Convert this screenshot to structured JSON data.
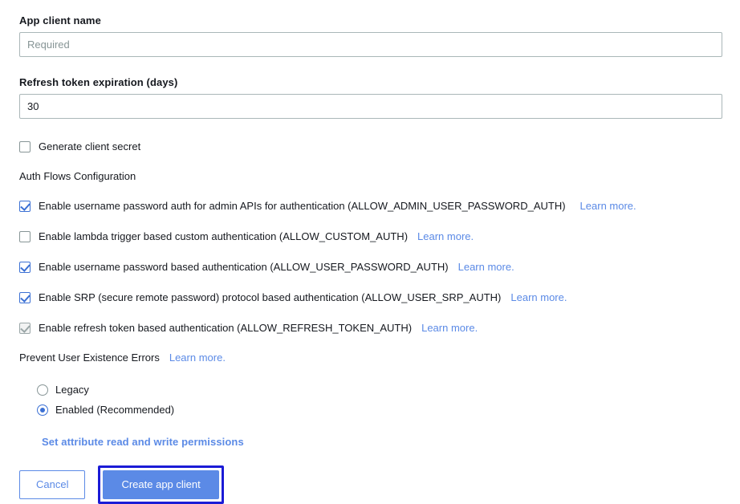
{
  "form": {
    "app_client_name": {
      "label": "App client name",
      "placeholder": "Required",
      "value": ""
    },
    "refresh_token_expiration": {
      "label": "Refresh token expiration (days)",
      "placeholder": "",
      "value": "30"
    },
    "generate_client_secret": {
      "label": "Generate client secret",
      "checked": false
    },
    "auth_flows": {
      "section_label": "Auth Flows Configuration",
      "items": [
        {
          "label": "Enable username password auth for admin APIs for authentication (ALLOW_ADMIN_USER_PASSWORD_AUTH)",
          "link": "Learn more.",
          "checked": true,
          "disabled": false
        },
        {
          "label": "Enable lambda trigger based custom authentication (ALLOW_CUSTOM_AUTH)",
          "link": "Learn more.",
          "checked": false,
          "disabled": false
        },
        {
          "label": "Enable username password based authentication (ALLOW_USER_PASSWORD_AUTH)",
          "link": "Learn more.",
          "checked": true,
          "disabled": false
        },
        {
          "label": "Enable SRP (secure remote password) protocol based authentication (ALLOW_USER_SRP_AUTH)",
          "link": "Learn more.",
          "checked": true,
          "disabled": false
        },
        {
          "label": "Enable refresh token based authentication (ALLOW_REFRESH_TOKEN_AUTH)",
          "link": "Learn more.",
          "checked": true,
          "disabled": true
        }
      ]
    },
    "prevent_user_existence_errors": {
      "label": "Prevent User Existence Errors",
      "link": "Learn more.",
      "options": [
        {
          "label": "Legacy",
          "selected": false
        },
        {
          "label": "Enabled (Recommended)",
          "selected": true
        }
      ]
    },
    "set_attribute_permissions_link": "Set attribute read and write permissions",
    "buttons": {
      "cancel": "Cancel",
      "create": "Create app client"
    }
  },
  "colors": {
    "accent": "#5b8ae6",
    "checked": "#3b70d4",
    "focus_ring": "#1b1bd6",
    "text": "#16191f",
    "border": "#aab7b8",
    "placeholder": "#879596"
  }
}
